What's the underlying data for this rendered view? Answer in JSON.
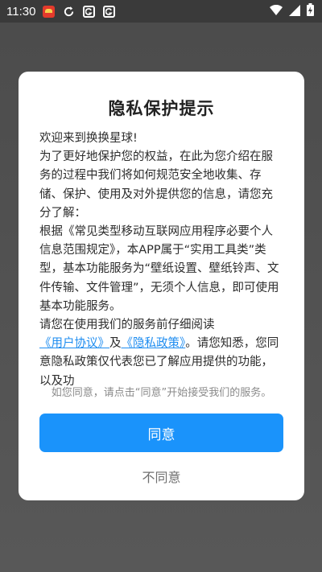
{
  "status_bar": {
    "time": "11:30",
    "left_icons": [
      "app-notification-icon",
      "sync-icon",
      "g-app-icon",
      "g-app-icon"
    ],
    "right_icons": [
      "wifi-icon",
      "signal-icon",
      "battery-icon"
    ]
  },
  "dialog": {
    "title": "隐私保护提示",
    "paragraphs": {
      "p1": "欢迎来到换换星球!",
      "p2": "为了更好地保护您的权益，在此为您介绍在服务的过程中我们将如何规范安全地收集、存储、保护、使用及对外提供您的信息，请您充分了解：",
      "p3": "根据《常见类型移动互联网应用程序必要个人信息范围规定》，本APP属于“实用工具类”类型，基本功能服务为“壁纸设置、壁纸铃声、文件传输、文件管理”，无须个人信息，即可使用基本功能服务。",
      "p4_prefix": "请您在使用我们的服务前仔细阅读",
      "user_agreement_link": "《用户协议》",
      "p4_and": "及",
      "privacy_policy_link": "《隐私政策》",
      "p4_suffix": "。请您知悉，您同意隐私政策仅代表您已了解应用提供的功能，以及功"
    },
    "notice": "如您同意，请点击“同意”开始接受我们的服务。",
    "agree_label": "同意",
    "disagree_label": "不同意"
  },
  "colors": {
    "accent": "#1a93fb",
    "link": "#1d8cf0",
    "backdrop": "#4e4e4e"
  }
}
